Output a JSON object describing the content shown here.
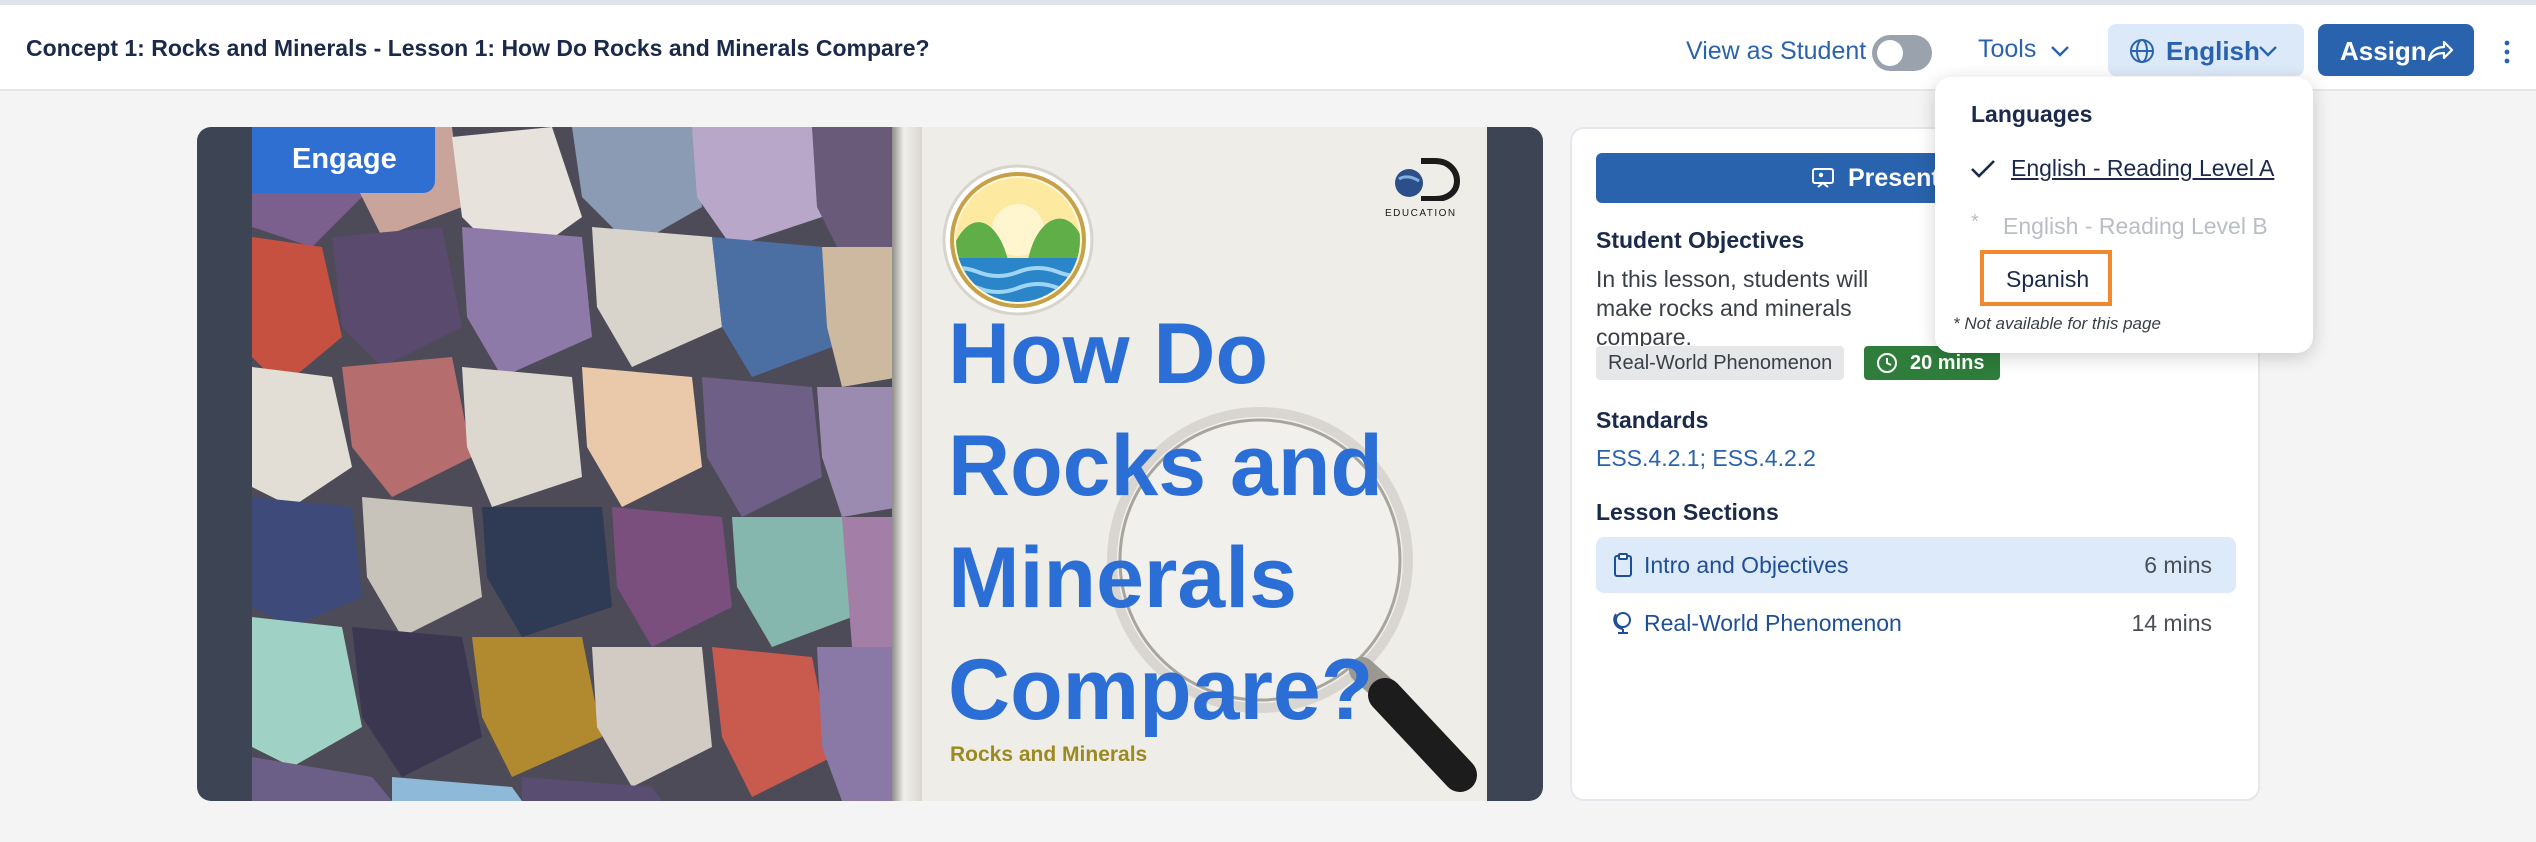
{
  "header": {
    "title": "Concept 1: Rocks and Minerals - Lesson 1: How Do Rocks and Minerals Compare?",
    "view_as_student": "View as Student",
    "view_as_student_on": false,
    "tools": "Tools",
    "language": "English",
    "assign": "Assign"
  },
  "hero": {
    "badge": "Engage",
    "title_lines": [
      "How Do",
      "Rocks and",
      "Minerals",
      "Compare?"
    ],
    "subject": "Rocks and Minerals",
    "logo_text": "EDUCATION"
  },
  "panel": {
    "present_label": "Present t",
    "objectives_heading": "Student Objectives",
    "objectives_text": "In this lesson, students will make rocks and minerals compare.",
    "tag_phenomenon": "Real-World Phenomenon",
    "tag_time": "20 mins",
    "standards_heading": "Standards",
    "standards": [
      "ESS.4.2.1",
      "ESS.4.2.2"
    ],
    "standards_separator": ";",
    "sections_heading": "Lesson Sections",
    "sections": [
      {
        "label": "Intro and Objectives",
        "time": "6 mins",
        "active": true
      },
      {
        "label": "Real-World Phenomenon",
        "time": "14 mins",
        "active": false
      }
    ]
  },
  "dropdown": {
    "title": "Languages",
    "options": [
      {
        "label": "English - Reading Level A",
        "selected": true
      },
      {
        "label": "English - Reading Level B",
        "available": false,
        "marker": "*"
      },
      {
        "label": "Spanish",
        "highlighted": true
      }
    ],
    "note": "* Not available for this page"
  },
  "colors": {
    "primary": "#2a63ad",
    "engage": "#2f6fd1",
    "time_badge": "#2e7d3a",
    "highlight": "#f2892e",
    "title_blue": "#2b6ed6"
  }
}
